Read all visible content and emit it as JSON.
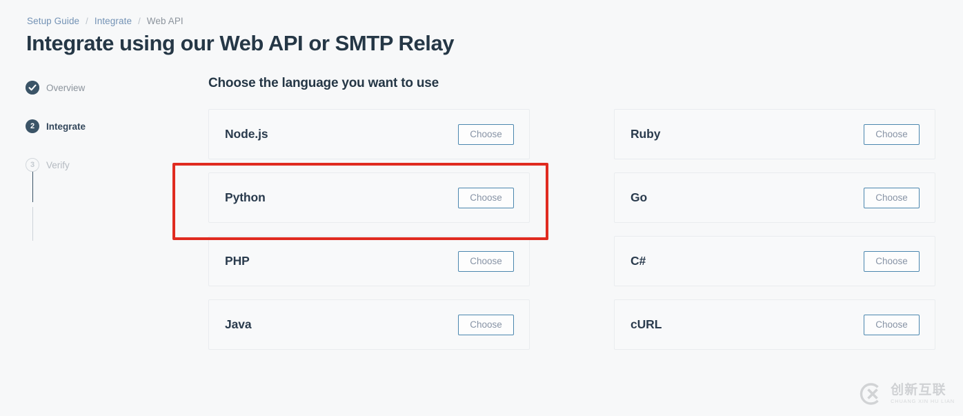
{
  "breadcrumb": {
    "items": [
      {
        "label": "Setup Guide",
        "type": "link"
      },
      {
        "label": "Integrate",
        "type": "link"
      },
      {
        "label": "Web API",
        "type": "current"
      }
    ],
    "separator": "/"
  },
  "page_title": "Integrate using our Web API or SMTP Relay",
  "stepper": {
    "steps": [
      {
        "number": "1",
        "label": "Overview",
        "state": "done",
        "marker": "check-icon"
      },
      {
        "number": "2",
        "label": "Integrate",
        "state": "current",
        "marker": "2"
      },
      {
        "number": "3",
        "label": "Verify",
        "state": "todo",
        "marker": "3"
      }
    ]
  },
  "main": {
    "section_title": "Choose the language you want to use",
    "choose_label": "Choose",
    "columns": [
      {
        "cards": [
          {
            "name": "Node.js",
            "button": "Choose"
          },
          {
            "name": "Python",
            "button": "Choose"
          },
          {
            "name": "PHP",
            "button": "Choose"
          },
          {
            "name": "Java",
            "button": "Choose"
          }
        ]
      },
      {
        "cards": [
          {
            "name": "Ruby",
            "button": "Choose"
          },
          {
            "name": "Go",
            "button": "Choose"
          },
          {
            "name": "C#",
            "button": "Choose"
          },
          {
            "name": "cURL",
            "button": "Choose"
          }
        ]
      }
    ]
  },
  "annotation": {
    "target": "Python",
    "color": "#e02b20"
  },
  "watermark": {
    "chinese": "创新互联",
    "pinyin": "CHUANG XIN HU LIAN",
    "logo": "cx-circle-logo"
  },
  "colors": {
    "page_background": "#f7f8f9",
    "title": "#253746",
    "link": "#7392b5",
    "card_background": "#f8f9fa",
    "card_border": "#e9ecef",
    "button_border": "#4a86ae",
    "button_text": "#8793a5",
    "step_active": "#3b5467",
    "annotation_red": "#e02b20"
  }
}
